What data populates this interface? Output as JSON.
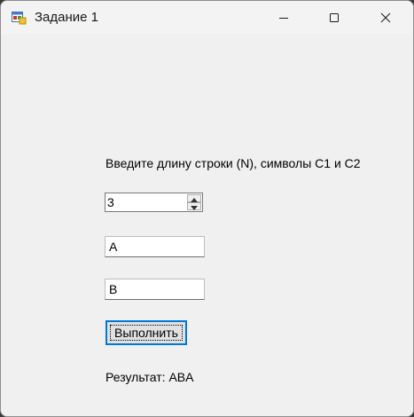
{
  "window": {
    "title": "Задание 1",
    "app_icon": "windows-form-icon",
    "controls": {
      "minimize_icon": "minimize-icon",
      "maximize_icon": "maximize-icon",
      "close_icon": "close-icon"
    }
  },
  "form": {
    "prompt": "Введите длину строки (N), символы C1 и C2",
    "n_value": "3",
    "c1_value": "A",
    "c2_value": "B",
    "run_button": "Выполнить",
    "result": "Результат: ABA"
  },
  "colors": {
    "focus_accent": "#0078d7",
    "window_bg": "#f0f0f0"
  }
}
